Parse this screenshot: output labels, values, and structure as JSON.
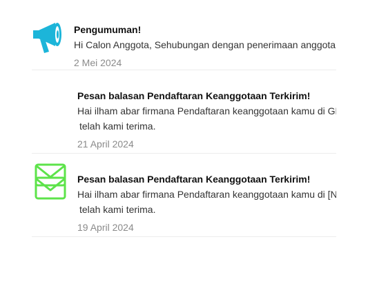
{
  "notifications": [
    {
      "icon": "megaphone-icon",
      "title": "Pengumuman!",
      "message": "Hi Calon Anggota, Sehubungan dengan penerimaan anggota baru",
      "message_line2": "",
      "date": "2 Mei 2024"
    },
    {
      "icon": "mail-icon",
      "title": "Pesan balasan Pendaftaran Keanggotaan Terkirim!",
      "message": "Hai ilham abar firmana Pendaftaran keanggotaan kamu di GMN",
      "message_line2": "telah kami terima.",
      "date": "21 April 2024"
    },
    {
      "icon": "mail-icon",
      "title": "Pesan balasan Pendaftaran Keanggotaan Terkirim!",
      "message": "Hai ilham abar firmana Pendaftaran keanggotaan kamu di [N",
      "message_line2": "telah kami terima.",
      "date": "19 April 2024"
    }
  ],
  "colors": {
    "megaphone": "#1cb5d9",
    "mail": "#5de34a"
  }
}
